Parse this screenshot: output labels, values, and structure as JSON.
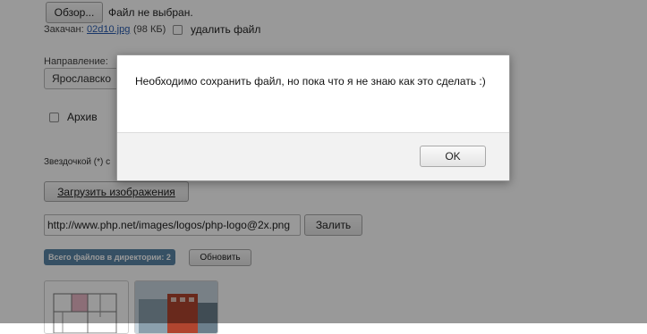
{
  "file_input": {
    "browse_label": "Обзор...",
    "status": "Файл не выбран."
  },
  "uploaded": {
    "label": "Закачан:",
    "file_name": "02d10.jpg",
    "file_size": "(98 КБ)",
    "delete_label": "удалить файл"
  },
  "direction": {
    "label": "Направление:",
    "selected_value": "Ярославско"
  },
  "archive": {
    "label": "Архив"
  },
  "note": {
    "text": "Звездочкой (*) с"
  },
  "upload_images_button": "Загрузить изображения",
  "url_upload": {
    "value": "http://www.php.net/images/logos/php-logo@2x.png",
    "submit_label": "Залить"
  },
  "directory": {
    "files_badge": "Всего файлов в директории: 2",
    "refresh_label": "Обновить"
  },
  "dialog": {
    "message": "Необходимо сохранить файл, но пока что я не знаю как это сделать :)",
    "ok_label": "OK"
  },
  "colors": {
    "badge_bg": "#5b86a7",
    "link": "#2a5db0",
    "overlay": "rgba(0,0,0,0.40)"
  }
}
